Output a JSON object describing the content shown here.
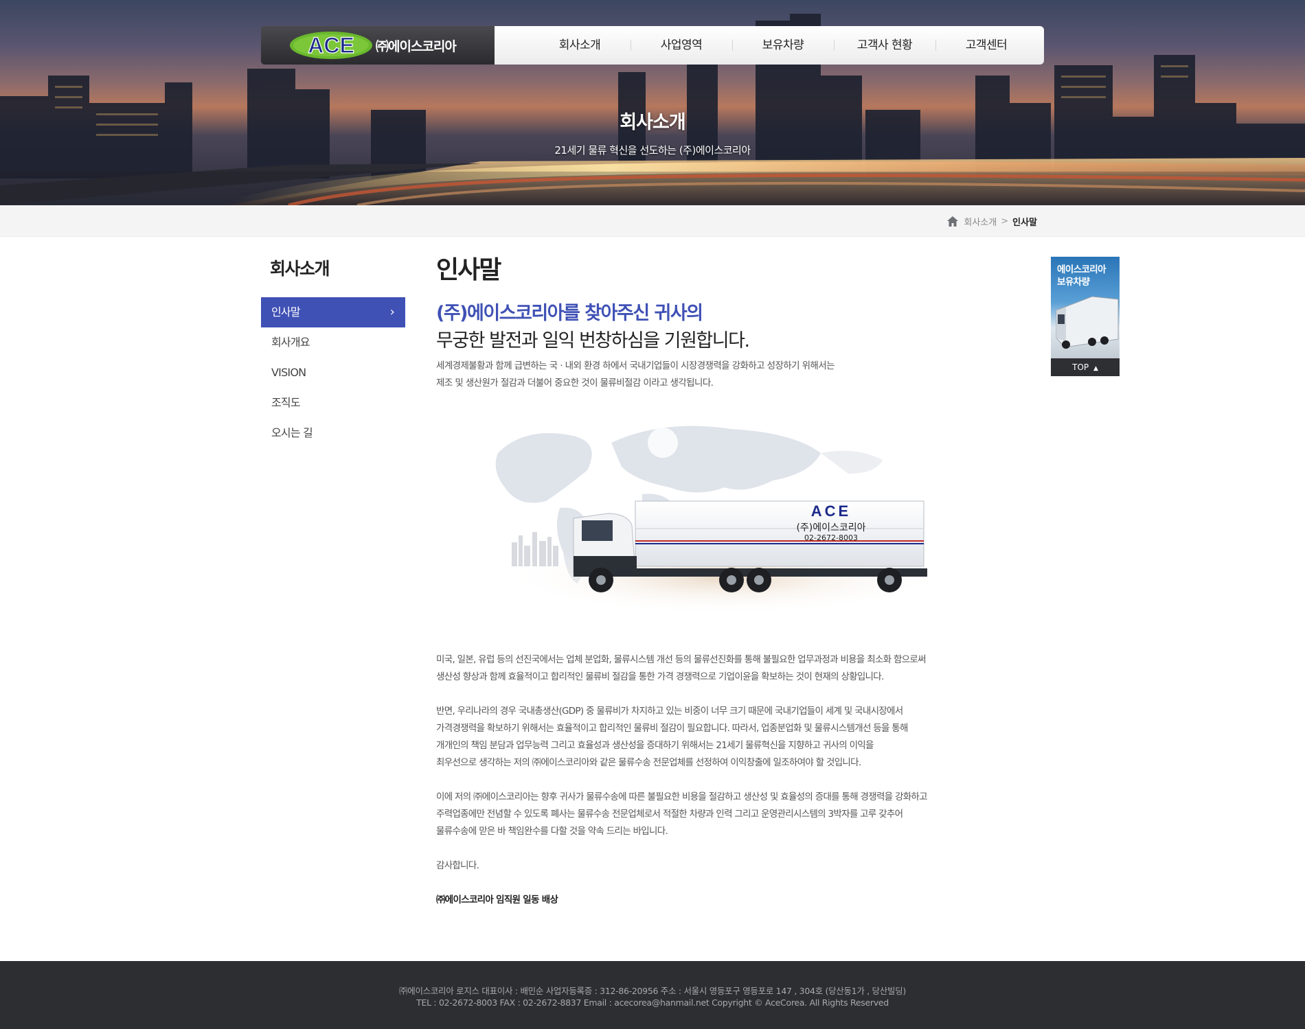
{
  "hero": {
    "title": "회사소개",
    "subtitle": "21세기 물류 혁신을 선도하는 (주)에이스코리아"
  },
  "header": {
    "logo_mark": "ACE",
    "logo_text": "㈜에이스코리아",
    "nav": [
      "회사소개",
      "사업영역",
      "보유차량",
      "고객사 현황",
      "고객센터"
    ]
  },
  "breadcrumb": {
    "parent": "회사소개",
    "separator": ">",
    "current": "인사말"
  },
  "sidebar": {
    "title": "회사소개",
    "items": [
      "인사말",
      "회사개요",
      "VISION",
      "조직도",
      "오시는 길"
    ],
    "active_index": 0
  },
  "main": {
    "title": "인사말",
    "lead_line1": "(주)에이스코리아를 찾아주신 귀사의",
    "lead_line2": "무궁한 발전과 일익 번창하심을 기원합니다.",
    "intro": [
      "세계경제불황과 함께 급변하는 국 · 내외 환경 하에서 국내기업들이 시장경쟁력을 강화하고 성장하기 위해서는",
      "제조 및 생산원가 절감과 더불어 중요한 것이 물류비절감 이라고 생각됩니다."
    ],
    "truck": {
      "brand": "ACE",
      "company": "(주)에이스코리아",
      "phone": "02-2672-8003"
    },
    "paragraphs": [
      [
        "미국, 일본, 유럽 등의 선진국에서는 업체 분업화, 물류시스템 개선 등의 물류선진화를 통해 불필요한 업무과정과 비용을 최소화 함으로써",
        "생산성 향상과 함께 효율적이고 합리적인 물류비 절감을 통한 가격 경쟁력으로 기업이윤을 확보하는 것이 현재의 상황입니다."
      ],
      [
        "반면, 우리나라의 경우 국내총생산(GDP) 중 물류비가 차지하고 있는 비중이 너무 크기 때문에 국내기업들이 세계 및 국내시장에서",
        "가격경쟁력을 확보하기 위해서는 효율적이고 합리적인 물류비 절감이 필요합니다. 따라서, 업종분업화 및 물류시스템개선 등을 통해",
        "개개인의 책임 분담과 업무능력 그리고 효율성과 생산성을 증대하기 위해서는 21세기 물류혁신을 지향하고 귀사의 이익을",
        "최우선으로 생각하는 저의 ㈜에이스코리아와 같은 물류수송 전문업체를 선정하여 이익창출에 일조하여야 할 것입니다."
      ],
      [
        "이에 저의 ㈜에이스코리아는 향후 귀사가 물류수송에 따른 불필요한 비용을 절감하고 생산성 및 효율성의 증대를 통해 경쟁력을 강화하고",
        "주력업종에만 전념할 수 있도록 폐사는 물류수송 전문업체로서 적절한 차량과 인력 그리고 운영관리시스템의 3박자를 고루 갖추어",
        "물류수송에 맏은 바 책임완수를 다할 것을 약속 드리는 바입니다."
      ],
      [
        "감사합니다."
      ]
    ],
    "signature": "㈜에이스코리아 임직원 일동 배상"
  },
  "quick_banner": {
    "line1": "에이스코리아",
    "line2": "보유차량",
    "top_label": "TOP"
  },
  "footer": {
    "line1": "㈜에이스코리아 로지스    대표이사 : 배민순    사업자등록증 : 312-86-20956    주소 : 서울시 영등포구 영등포로 147 , 304호 (당산동1가 , 당산빌딩)",
    "line2": "TEL : 02-2672-8003    FAX : 02-2672-8837    Email : acecorea@hanmail.net    Copyright © AceCorea. All Rights Reserved"
  },
  "colors": {
    "accent": "#3f51b5",
    "footer_bg": "#2d2e32",
    "logo_green": "#6ab82e"
  }
}
